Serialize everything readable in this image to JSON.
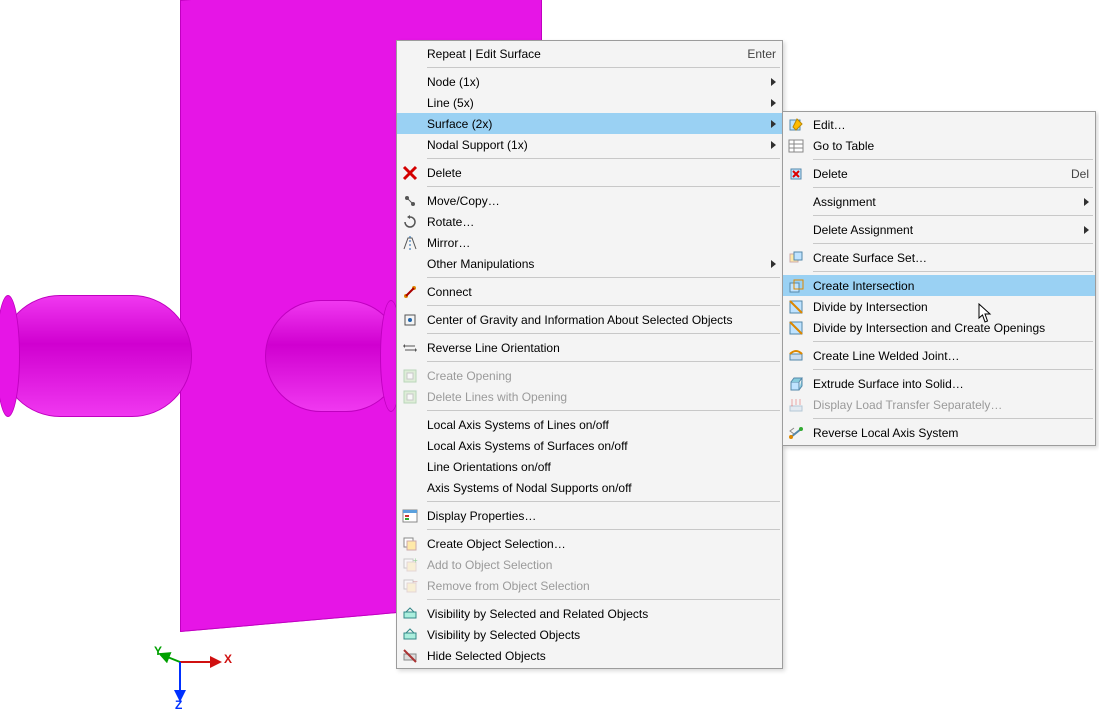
{
  "viewport": {
    "axis_x": "X",
    "axis_y": "Y",
    "axis_z": "Z",
    "axis_x_color": "#d01010",
    "axis_y_color": "#00a000",
    "axis_z_color": "#0030ff"
  },
  "menu_main": {
    "items": [
      {
        "label": "Repeat | Edit Surface",
        "accel": "Enter",
        "icon": "",
        "arrow": false,
        "sepAfter": true
      },
      {
        "label": "Node (1x)",
        "accel": "",
        "icon": "",
        "arrow": true,
        "sepAfter": false
      },
      {
        "label": "Line (5x)",
        "accel": "",
        "icon": "",
        "arrow": true,
        "sepAfter": false
      },
      {
        "label": "Surface (2x)",
        "accel": "",
        "icon": "",
        "arrow": true,
        "sepAfter": false,
        "highlight": true
      },
      {
        "label": "Nodal Support (1x)",
        "accel": "",
        "icon": "",
        "arrow": true,
        "sepAfter": true
      },
      {
        "label": "Delete",
        "accel": "",
        "icon": "x-red",
        "arrow": false,
        "sepAfter": true
      },
      {
        "label": "Move/Copy…",
        "accel": "",
        "icon": "move",
        "arrow": false,
        "sepAfter": false
      },
      {
        "label": "Rotate…",
        "accel": "",
        "icon": "rotate",
        "arrow": false,
        "sepAfter": false
      },
      {
        "label": "Mirror…",
        "accel": "",
        "icon": "mirror",
        "arrow": false,
        "sepAfter": false
      },
      {
        "label": "Other Manipulations",
        "accel": "",
        "icon": "",
        "arrow": true,
        "sepAfter": true
      },
      {
        "label": "Connect",
        "accel": "",
        "icon": "connect",
        "arrow": false,
        "sepAfter": true
      },
      {
        "label": "Center of Gravity and Information About Selected Objects",
        "accel": "",
        "icon": "cog",
        "arrow": false,
        "sepAfter": true
      },
      {
        "label": "Reverse Line Orientation",
        "accel": "",
        "icon": "rev",
        "arrow": false,
        "sepAfter": true
      },
      {
        "label": "Create Opening",
        "accel": "",
        "icon": "open",
        "arrow": false,
        "sepAfter": false,
        "disabled": true
      },
      {
        "label": "Delete Lines with Opening",
        "accel": "",
        "icon": "open",
        "arrow": false,
        "sepAfter": true,
        "disabled": true
      },
      {
        "label": "Local Axis Systems of Lines on/off",
        "accel": "",
        "icon": "",
        "arrow": false,
        "sepAfter": false
      },
      {
        "label": "Local Axis Systems of Surfaces on/off",
        "accel": "",
        "icon": "",
        "arrow": false,
        "sepAfter": false
      },
      {
        "label": "Line Orientations on/off",
        "accel": "",
        "icon": "",
        "arrow": false,
        "sepAfter": false
      },
      {
        "label": "Axis Systems of Nodal Supports on/off",
        "accel": "",
        "icon": "",
        "arrow": false,
        "sepAfter": true
      },
      {
        "label": "Display Properties…",
        "accel": "",
        "icon": "prop",
        "arrow": false,
        "sepAfter": true
      },
      {
        "label": "Create Object Selection…",
        "accel": "",
        "icon": "sel",
        "arrow": false,
        "sepAfter": false
      },
      {
        "label": "Add to Object Selection",
        "accel": "",
        "icon": "seladd",
        "arrow": false,
        "sepAfter": false,
        "disabled": true
      },
      {
        "label": "Remove from Object Selection",
        "accel": "",
        "icon": "selrem",
        "arrow": false,
        "sepAfter": true,
        "disabled": true
      },
      {
        "label": "Visibility by Selected and Related Objects",
        "accel": "",
        "icon": "vis",
        "arrow": false,
        "sepAfter": false
      },
      {
        "label": "Visibility by Selected Objects",
        "accel": "",
        "icon": "vis",
        "arrow": false,
        "sepAfter": false
      },
      {
        "label": "Hide Selected Objects",
        "accel": "",
        "icon": "hide",
        "arrow": false,
        "sepAfter": false
      }
    ]
  },
  "menu_sub": {
    "items": [
      {
        "label": "Edit…",
        "accel": "",
        "icon": "edit",
        "arrow": false,
        "sepAfter": false
      },
      {
        "label": "Go to Table",
        "accel": "",
        "icon": "table",
        "arrow": false,
        "sepAfter": true
      },
      {
        "label": "Delete",
        "accel": "Del",
        "icon": "del",
        "arrow": false,
        "sepAfter": true
      },
      {
        "label": "Assignment",
        "accel": "",
        "icon": "",
        "arrow": true,
        "sepAfter": true
      },
      {
        "label": "Delete Assignment",
        "accel": "",
        "icon": "",
        "arrow": true,
        "sepAfter": true
      },
      {
        "label": "Create Surface Set…",
        "accel": "",
        "icon": "set",
        "arrow": false,
        "sepAfter": true
      },
      {
        "label": "Create Intersection",
        "accel": "",
        "icon": "int",
        "arrow": false,
        "sepAfter": false,
        "highlight": true
      },
      {
        "label": "Divide by Intersection",
        "accel": "",
        "icon": "div",
        "arrow": false,
        "sepAfter": false
      },
      {
        "label": "Divide by Intersection and Create Openings",
        "accel": "",
        "icon": "div",
        "arrow": false,
        "sepAfter": true
      },
      {
        "label": "Create Line Welded Joint…",
        "accel": "",
        "icon": "weld",
        "arrow": false,
        "sepAfter": true
      },
      {
        "label": "Extrude Surface into Solid…",
        "accel": "",
        "icon": "extr",
        "arrow": false,
        "sepAfter": false
      },
      {
        "label": "Display Load Transfer Separately…",
        "accel": "",
        "icon": "load",
        "arrow": false,
        "sepAfter": true,
        "disabled": true
      },
      {
        "label": "Reverse Local Axis System",
        "accel": "",
        "icon": "revax",
        "arrow": false,
        "sepAfter": false
      }
    ]
  }
}
